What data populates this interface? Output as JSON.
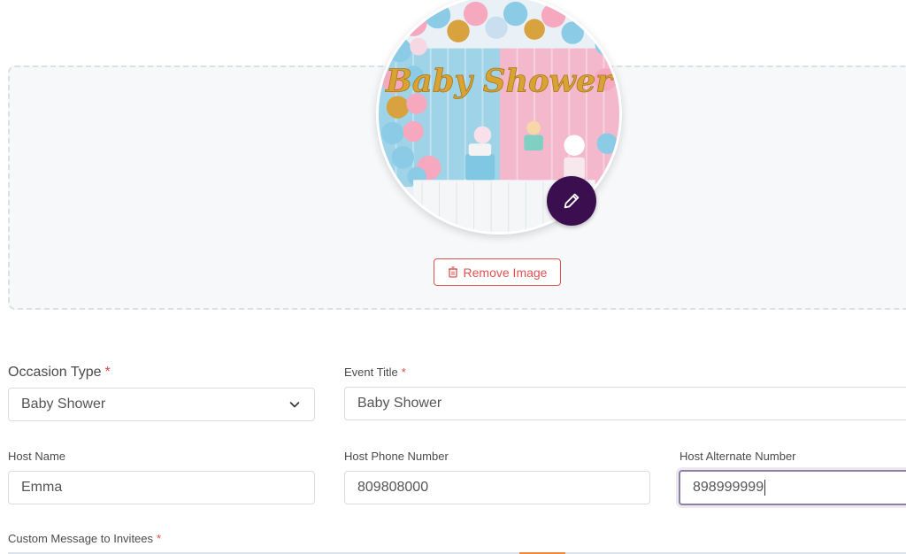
{
  "image_upload": {
    "image_alt": "Baby Shower",
    "image_caption": "Baby Shower",
    "remove_label": "Remove Image"
  },
  "form": {
    "occasion_type": {
      "label": "Occasion Type",
      "required_mark": "*",
      "value": "Baby Shower"
    },
    "event_title": {
      "label": "Event Title",
      "required_mark": "*",
      "value": "Baby Shower"
    },
    "host_name": {
      "label": "Host Name",
      "value": "Emma"
    },
    "host_phone": {
      "label": "Host Phone Number",
      "value": "809808000"
    },
    "host_alt": {
      "label": "Host Alternate Number",
      "value": "898999999"
    },
    "custom_message": {
      "label": "Custom Message to Invitees",
      "required_mark": "*"
    }
  },
  "colors": {
    "accent_purple": "#3b0f4f",
    "danger_red": "#e05252",
    "focus_border": "#8e7fa6"
  }
}
